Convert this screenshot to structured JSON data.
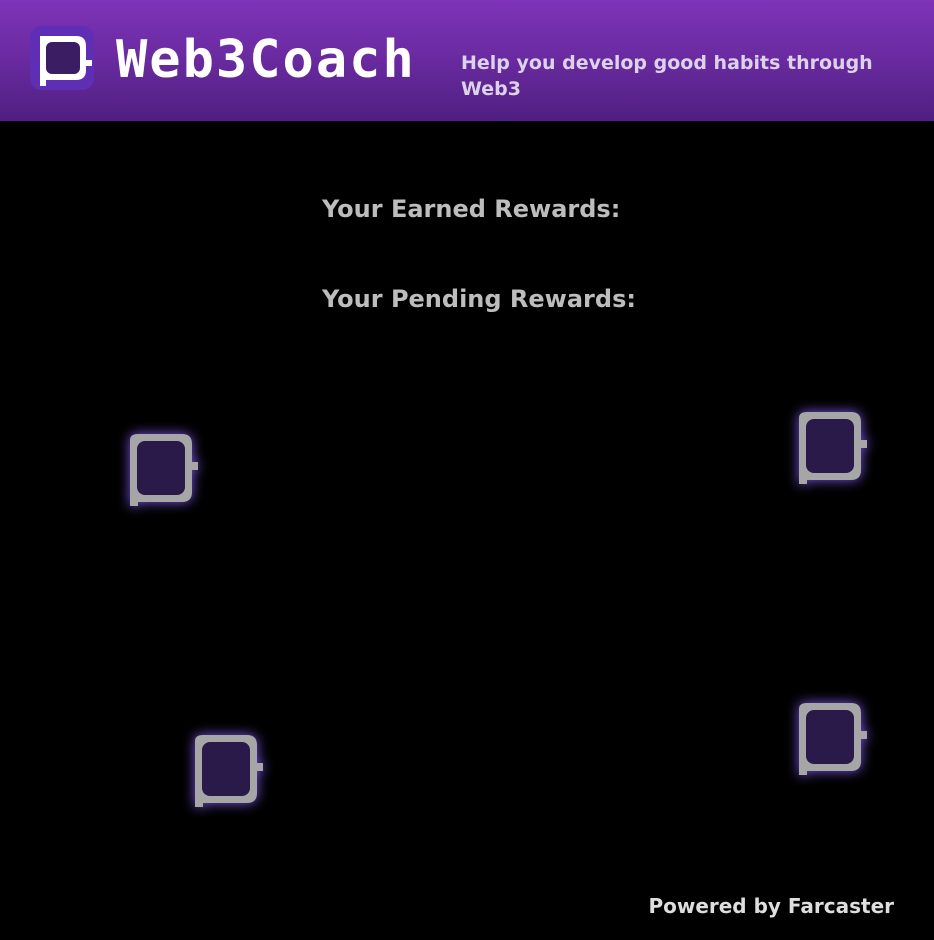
{
  "header": {
    "logo_icon": "web3coach-logo-icon",
    "brand": "Web3Coach",
    "tagline": "Help you develop good habits through Web3",
    "accent_color": "#7e33b8"
  },
  "rewards": {
    "earned_label": "Your Earned Rewards:",
    "pending_label": "Your Pending Rewards:"
  },
  "decorations": {
    "icon": "web3coach-logo-icon"
  },
  "footer": {
    "powered_by": "Powered by Farcaster"
  }
}
